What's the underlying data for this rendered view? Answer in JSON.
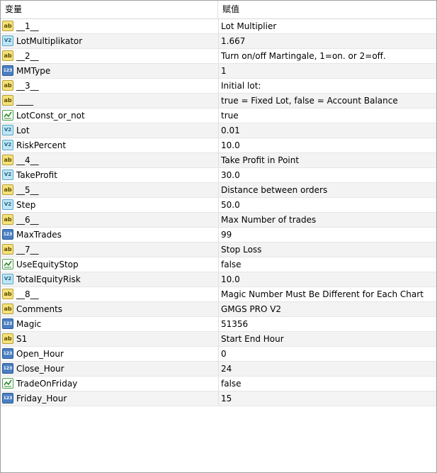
{
  "header": {
    "variable_label": "变量",
    "value_label": "赋值"
  },
  "icons": {
    "string": {
      "name": "string-type-icon",
      "glyph": "ab"
    },
    "double": {
      "name": "double-type-icon",
      "glyph": "V2"
    },
    "int": {
      "name": "integer-type-icon",
      "glyph": "123"
    },
    "bool": {
      "name": "boolean-type-icon",
      "glyph": ""
    }
  },
  "rows": [
    {
      "type": "string",
      "name": "__1__",
      "value": "Lot Multiplier"
    },
    {
      "type": "double",
      "name": "LotMultiplikator",
      "value": "1.667"
    },
    {
      "type": "string",
      "name": "__2__",
      "value": " Turn on/off Martingale,  1=on. or 2=off."
    },
    {
      "type": "int",
      "name": "MMType",
      "value": "1"
    },
    {
      "type": "string",
      "name": "__3__",
      "value": "Initial lot:"
    },
    {
      "type": "string",
      "name": "____",
      "value": "true = Fixed Lot, false = Account Balance"
    },
    {
      "type": "bool",
      "name": "LotConst_or_not",
      "value": "true"
    },
    {
      "type": "double",
      "name": "Lot",
      "value": "0.01"
    },
    {
      "type": "double",
      "name": "RiskPercent",
      "value": "10.0"
    },
    {
      "type": "string",
      "name": "__4__",
      "value": "Take Profit in Point"
    },
    {
      "type": "double",
      "name": "TakeProfit",
      "value": "30.0"
    },
    {
      "type": "string",
      "name": "__5__",
      "value": "Distance between orders"
    },
    {
      "type": "double",
      "name": "Step",
      "value": "50.0"
    },
    {
      "type": "string",
      "name": "__6__",
      "value": "Max Number of trades"
    },
    {
      "type": "int",
      "name": "MaxTrades",
      "value": "99"
    },
    {
      "type": "string",
      "name": "__7__",
      "value": "Stop Loss"
    },
    {
      "type": "bool",
      "name": "UseEquityStop",
      "value": "false"
    },
    {
      "type": "double",
      "name": "TotalEquityRisk",
      "value": "10.0"
    },
    {
      "type": "string",
      "name": "__8__",
      "value": "Magic Number Must Be Different for Each Chart"
    },
    {
      "type": "string",
      "name": "Comments",
      "value": " GMGS PRO V2"
    },
    {
      "type": "int",
      "name": "Magic",
      "value": "51356"
    },
    {
      "type": "string",
      "name": "S1",
      "value": " Start End Hour"
    },
    {
      "type": "int",
      "name": "Open_Hour",
      "value": "0"
    },
    {
      "type": "int",
      "name": "Close_Hour",
      "value": "24"
    },
    {
      "type": "bool",
      "name": "TradeOnFriday",
      "value": "false"
    },
    {
      "type": "int",
      "name": "Friday_Hour",
      "value": "15"
    }
  ]
}
